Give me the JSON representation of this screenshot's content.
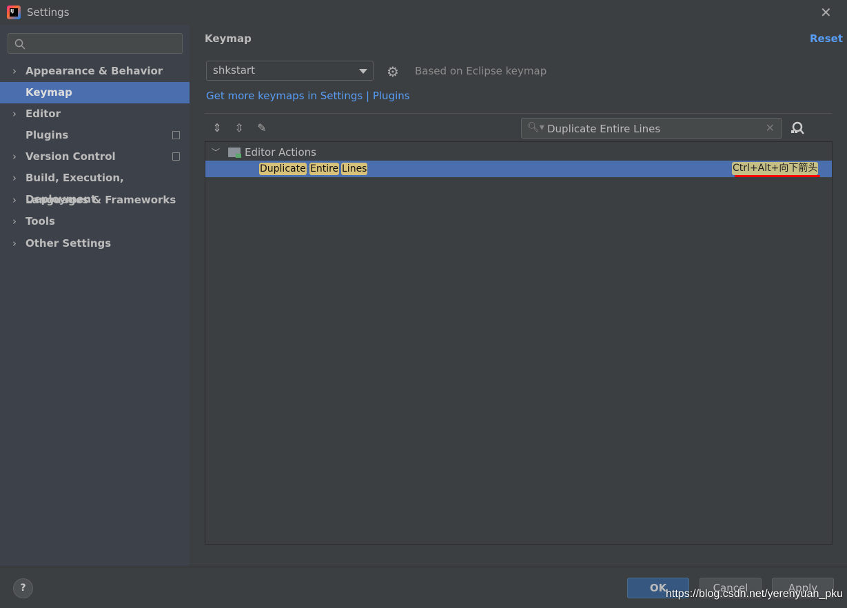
{
  "window": {
    "title": "Settings"
  },
  "sidebar": {
    "search_placeholder": "",
    "items": [
      {
        "label": "Appearance & Behavior",
        "expandable": true
      },
      {
        "label": "Keymap",
        "selected": true
      },
      {
        "label": "Editor",
        "expandable": true
      },
      {
        "label": "Plugins",
        "project_icon": true
      },
      {
        "label": "Version Control",
        "expandable": true,
        "project_icon": true
      },
      {
        "label": "Build, Execution, Deployment",
        "expandable": true
      },
      {
        "label": "Languages & Frameworks",
        "expandable": true
      },
      {
        "label": "Tools",
        "expandable": true
      },
      {
        "label": "Other Settings",
        "expandable": true
      }
    ]
  },
  "main": {
    "title": "Keymap",
    "reset": "Reset",
    "keymap_select": "shkstart",
    "based_on": "Based on Eclipse keymap",
    "get_more": "Get more keymaps in Settings | Plugins",
    "search_value": "Duplicate Entire Lines",
    "tree": {
      "group": "Editor Actions",
      "action_words": [
        "Duplicate",
        "Entire",
        "Lines"
      ],
      "shortcut": "Ctrl+Alt+向下箭头"
    }
  },
  "footer": {
    "ok": "OK",
    "cancel": "Cancel",
    "apply": "Apply",
    "help": "?"
  },
  "watermark": "https://blog.csdn.net/yerenyuan_pku",
  "colors": {
    "accent": "#4b6eaf",
    "link": "#589df6",
    "highlight": "#d8c27a",
    "underline": "#ff0000"
  }
}
